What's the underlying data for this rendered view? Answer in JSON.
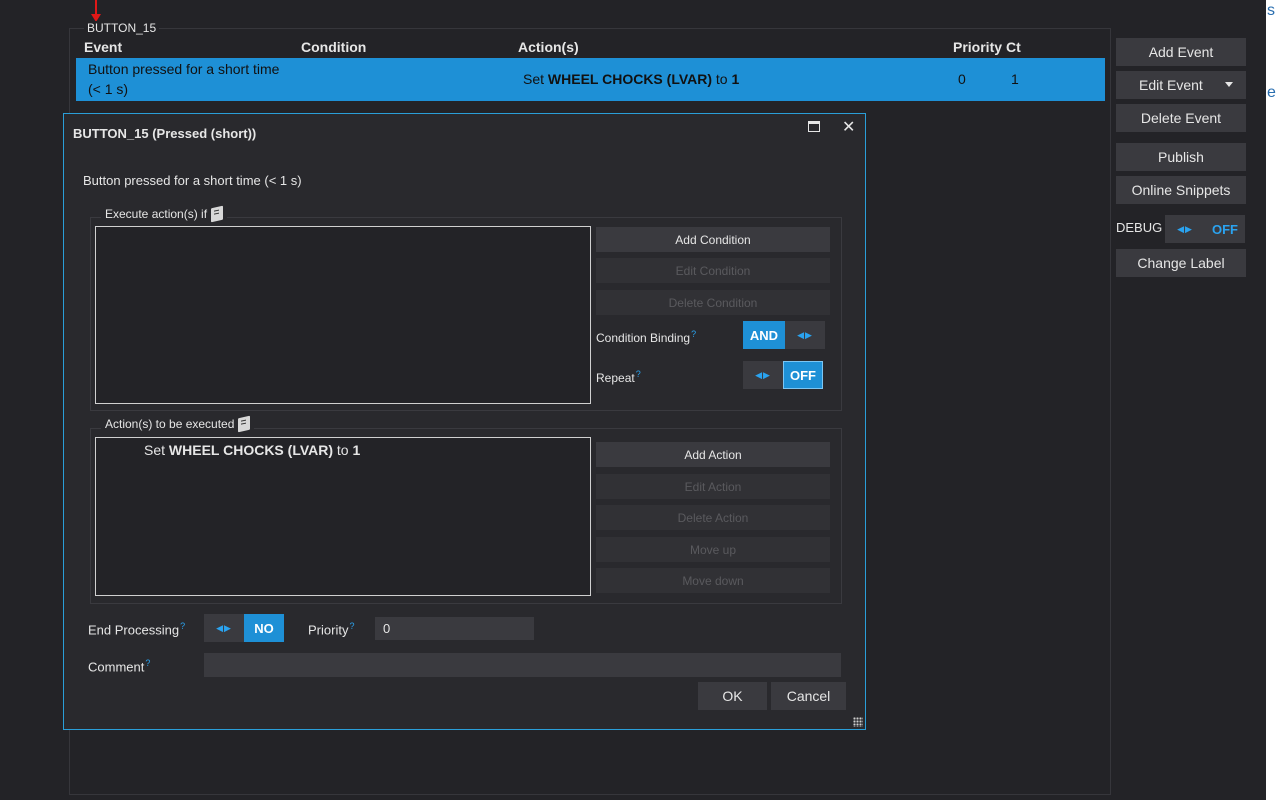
{
  "group": {
    "title": "BUTTON_15"
  },
  "table": {
    "headers": {
      "event": "Event",
      "condition": "Condition",
      "actions": "Action(s)",
      "priority": "Priority",
      "ct": "Ct"
    },
    "selected_row": {
      "event_line1": "Button pressed for a short time",
      "event_line2": "(< 1 s)",
      "action_prefix": "Set",
      "action_target": "WHEEL CHOCKS (LVAR)",
      "action_mid": "to",
      "action_value": "1",
      "priority": "0",
      "ct": "1"
    }
  },
  "sidebar": {
    "add_event": "Add Event",
    "edit_event": "Edit Event",
    "delete_event": "Delete Event",
    "publish": "Publish",
    "online_snippets": "Online Snippets",
    "debug_label": "DEBUG",
    "debug_value": "OFF",
    "change_label": "Change Label"
  },
  "right_strip": {
    "c1": "s",
    "c2": "e"
  },
  "dialog": {
    "title": "BUTTON_15 (Pressed (short))",
    "description": "Button pressed for a short time (< 1 s)",
    "conditions": {
      "legend": "Execute action(s) if",
      "add": "Add Condition",
      "edit": "Edit Condition",
      "delete": "Delete Condition",
      "binding_label": "Condition Binding",
      "binding_value": "AND",
      "repeat_label": "Repeat",
      "repeat_value": "OFF"
    },
    "actions": {
      "legend": "Action(s) to be executed",
      "item_prefix": "Set",
      "item_target": "WHEEL CHOCKS (LVAR)",
      "item_mid": "to",
      "item_value": "1",
      "add": "Add Action",
      "edit": "Edit Action",
      "delete": "Delete Action",
      "move_up": "Move up",
      "move_down": "Move down"
    },
    "end_processing": {
      "label": "End Processing",
      "value": "NO"
    },
    "priority": {
      "label": "Priority",
      "value": "0"
    },
    "comment": {
      "label": "Comment",
      "value": ""
    },
    "ok": "OK",
    "cancel": "Cancel"
  },
  "help_mark": "?",
  "colors": {
    "accent": "#1e90d6",
    "dialog_border": "#2a9ed8",
    "background": "#232327"
  }
}
